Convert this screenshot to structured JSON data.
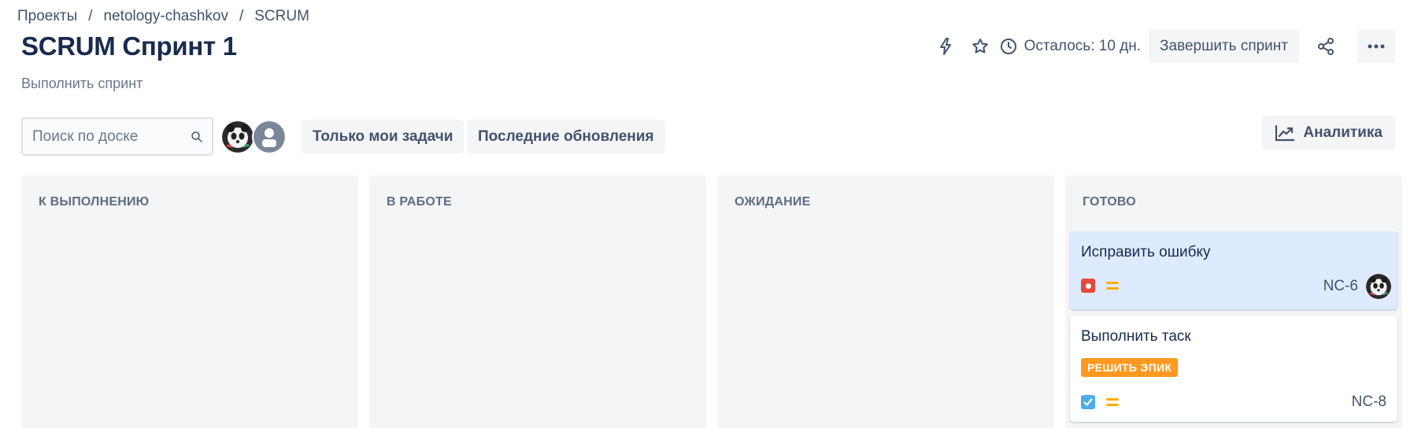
{
  "breadcrumb": {
    "items": [
      "Проекты",
      "netology-chashkov",
      "SCRUM"
    ],
    "separator": "/"
  },
  "title": "SCRUM Спринт 1",
  "subtitle": "Выполнить спринт",
  "header": {
    "remaining": "Осталось: 10 дн.",
    "complete_sprint": "Завершить спринт",
    "icons": [
      "lightning-icon",
      "star-icon",
      "clock-icon",
      "share-icon",
      "more-icon"
    ]
  },
  "filters": {
    "search_placeholder": "Поиск по доске",
    "only_my_issues": "Только мои задачи",
    "recent_updates": "Последние обновления",
    "analytics": "Аналитика"
  },
  "columns": [
    {
      "title": "К ВЫПОЛНЕНИЮ"
    },
    {
      "title": "В РАБОТЕ"
    },
    {
      "title": "ОЖИДАНИЕ"
    },
    {
      "title": "ГОТОВО"
    }
  ],
  "cards": [
    {
      "title": "Исправить ошибку",
      "key": "NC-6",
      "type": "bug",
      "priority": "medium",
      "has_assignee": true
    },
    {
      "title": "Выполнить таск",
      "key": "NC-8",
      "type": "task",
      "priority": "medium",
      "epic": "РЕШИТЬ ЭПИК"
    }
  ],
  "colors": {
    "text_primary": "#172b4d",
    "text_secondary": "#42526e",
    "column_bg": "#f4f5f7",
    "selected_card": "#deebff",
    "epic_badge": "#ff991f",
    "bug": "#e5493a",
    "task": "#4bade8",
    "priority_medium": "#ffab00"
  }
}
